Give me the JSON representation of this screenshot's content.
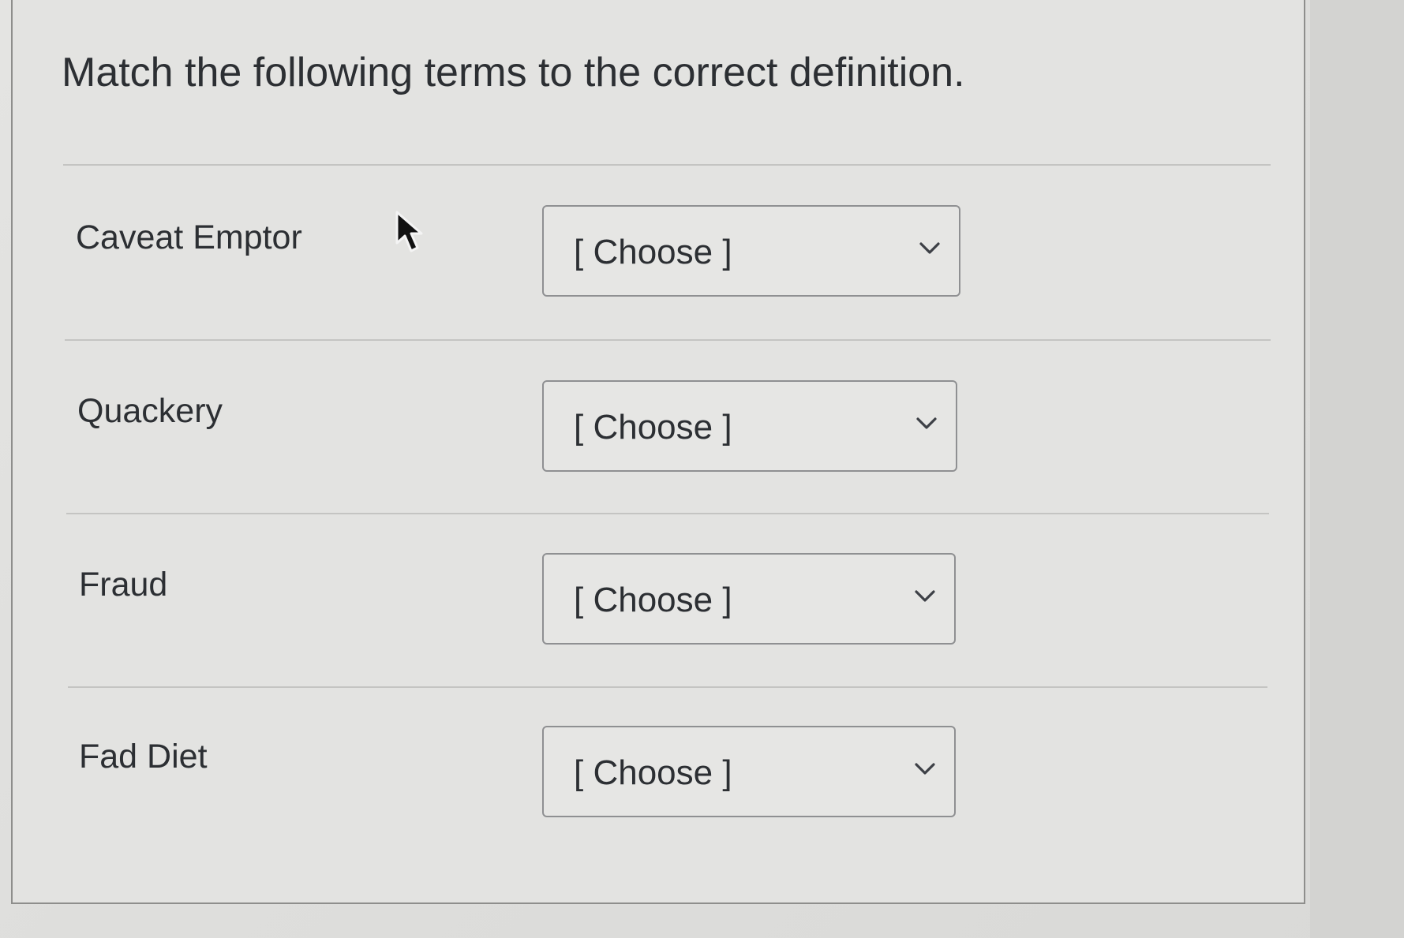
{
  "question": {
    "prompt": "Match the following terms to the correct definition."
  },
  "matches": [
    {
      "term": "Caveat Emptor",
      "selected": "[ Choose ]"
    },
    {
      "term": "Quackery",
      "selected": "[ Choose ]"
    },
    {
      "term": "Fraud",
      "selected": "[ Choose ]"
    },
    {
      "term": "Fad Diet",
      "selected": "[ Choose ]"
    }
  ],
  "icons": {
    "dropdown": "chevron-down-icon",
    "pointer": "mouse-cursor-icon"
  }
}
